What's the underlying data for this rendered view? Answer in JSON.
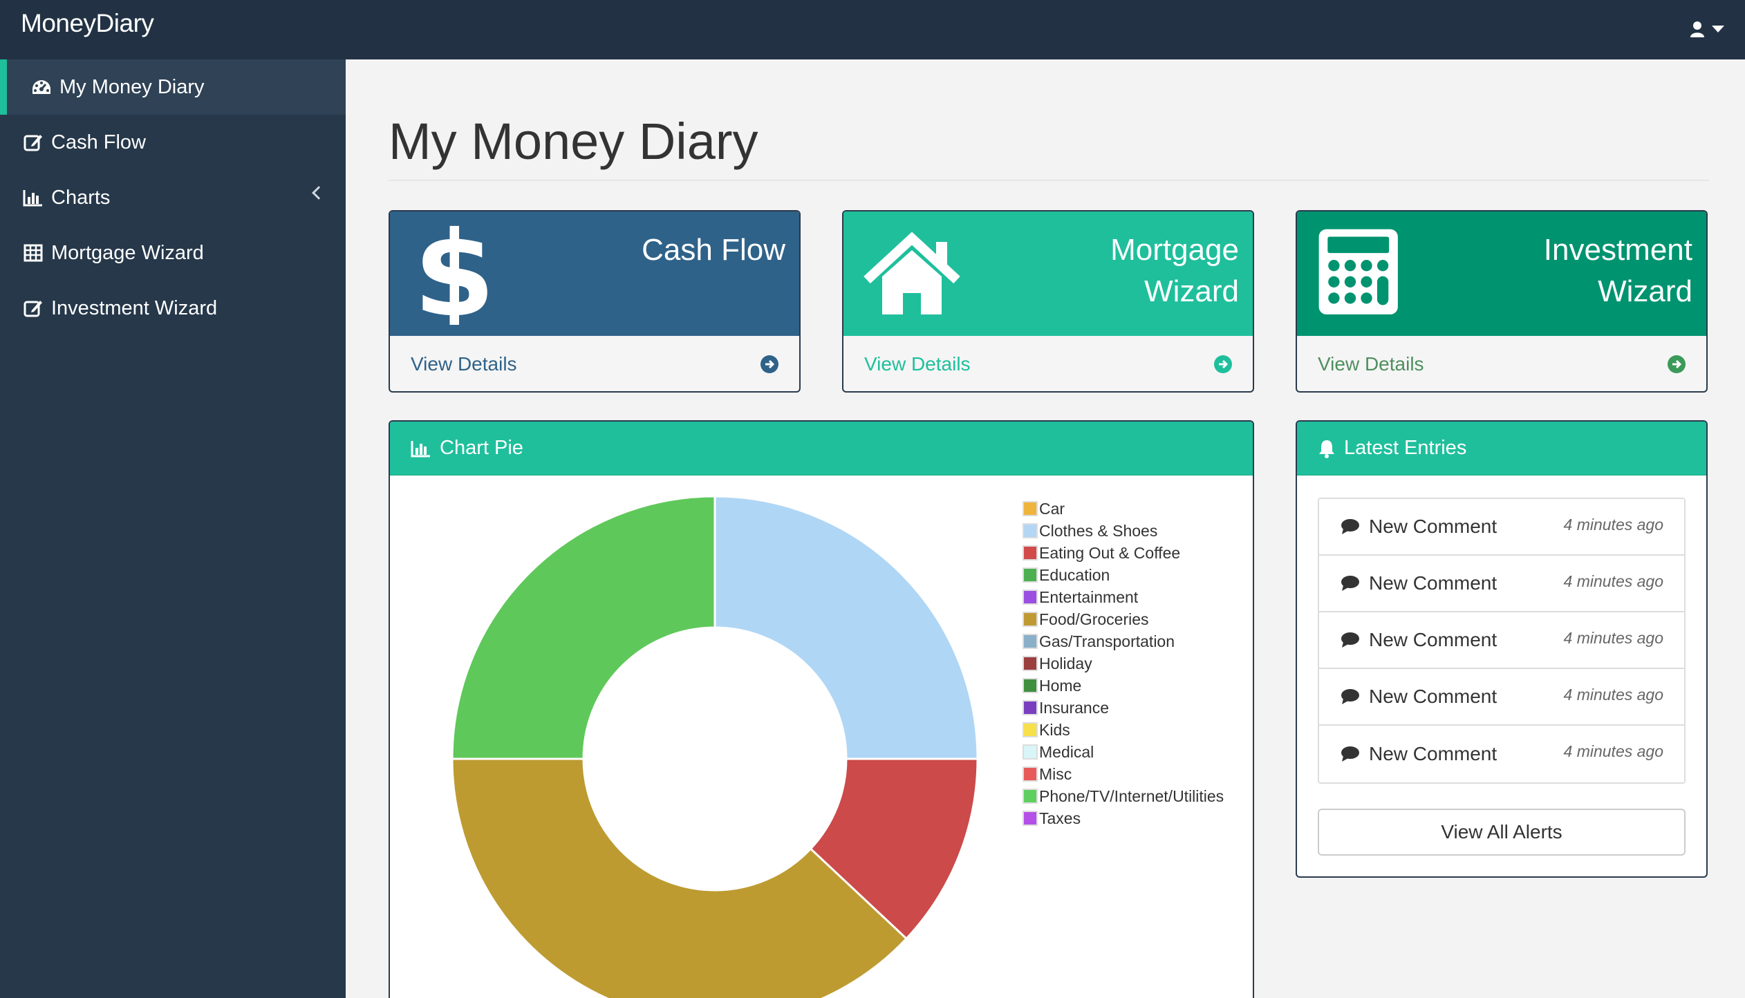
{
  "app": {
    "brand": "MoneyDiary"
  },
  "header": {
    "user_icon": "user-icon"
  },
  "sidebar": {
    "items": [
      {
        "label": "My Money Diary",
        "icon": "dashboard-icon"
      },
      {
        "label": "Cash Flow",
        "icon": "edit-icon"
      },
      {
        "label": "Charts",
        "icon": "bar-chart-icon"
      },
      {
        "label": "Mortgage Wizard",
        "icon": "table-icon"
      },
      {
        "label": "Investment Wizard",
        "icon": "edit-icon"
      }
    ]
  },
  "main": {
    "title": "My Money Diary"
  },
  "cards": [
    {
      "title": "Cash Flow",
      "link": "View Details",
      "color": "#2f6289",
      "icon": "dollar-icon"
    },
    {
      "title_line1": "Mortgage",
      "title_line2": "Wizard",
      "link": "View Details",
      "color": "#1fbf9c",
      "icon": "home-icon"
    },
    {
      "title_line1": "Investment",
      "title_line2": "Wizard",
      "link": "View Details",
      "color": "#00936f",
      "icon": "calculator-icon"
    }
  ],
  "chart_panel": {
    "title": "Chart Pie"
  },
  "chart_data": {
    "type": "pie",
    "donut": true,
    "categories": [
      "Car",
      "Clothes & Shoes",
      "Eating Out & Coffee",
      "Education",
      "Entertainment",
      "Food/Groceries",
      "Gas/Transportation",
      "Holiday",
      "Home",
      "Insurance",
      "Kids",
      "Medical",
      "Misc",
      "Phone/TV/Internet/Utilities",
      "Taxes"
    ],
    "colors": [
      "#f0b43c",
      "#b3d6f5",
      "#d24a4a",
      "#4caf50",
      "#9b4fe0",
      "#bf9a33",
      "#8aafc8",
      "#9b3f3f",
      "#3f8f3f",
      "#7a3fbf",
      "#f7e04a",
      "#d8f5f7",
      "#e85a5a",
      "#5fd05f",
      "#b44fe8"
    ],
    "values": [
      0,
      25,
      12,
      0,
      0,
      38,
      0,
      0,
      0,
      0,
      0,
      0,
      0,
      25,
      0
    ],
    "slice_colors": [
      "#b0d6f5",
      "#cc4a4a",
      "#bd9b31",
      "#5fc85a"
    ]
  },
  "latest": {
    "title": "Latest Entries",
    "entries": [
      {
        "text": "New Comment",
        "time": "4 minutes ago"
      },
      {
        "text": "New Comment",
        "time": "4 minutes ago"
      },
      {
        "text": "New Comment",
        "time": "4 minutes ago"
      },
      {
        "text": "New Comment",
        "time": "4 minutes ago"
      },
      {
        "text": "New Comment",
        "time": "4 minutes ago"
      }
    ],
    "view_all": "View All Alerts"
  }
}
